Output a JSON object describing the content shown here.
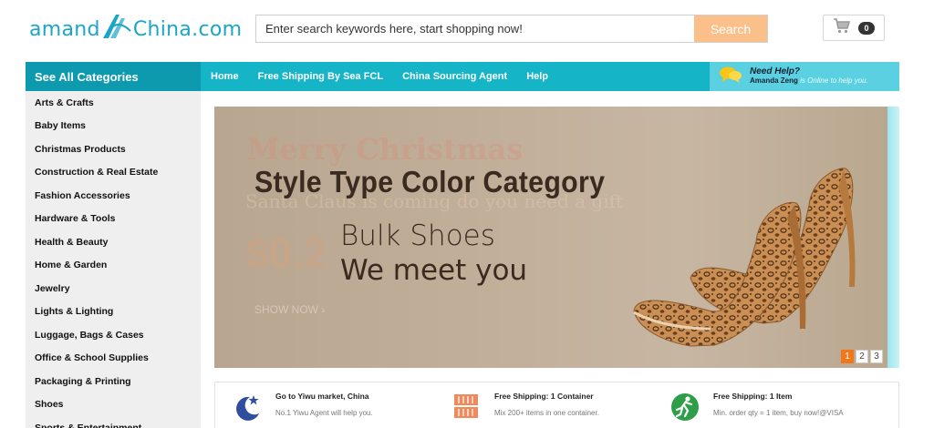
{
  "header": {
    "logo_left": "amand",
    "logo_right": "China.com",
    "search_placeholder": "Enter search keywords here, start shopping now!",
    "search_button": "Search",
    "cart_count": "0"
  },
  "nav": {
    "categories_label": "See All Categories",
    "links": [
      "Home",
      "Free Shipping By Sea FCL",
      "China Sourcing Agent",
      "Help"
    ],
    "help_title": "Need Help?",
    "help_name": "Amanda Zeng",
    "help_status": "is Online to help you."
  },
  "sidebar": {
    "items": [
      "Arts & Crafts",
      "Baby Items",
      "Christmas Products",
      "Construction & Real Estate",
      "Fashion Accessories",
      "Hardware & Tools",
      "Health & Beauty",
      "Home & Garden",
      "Jewelry",
      "Lights & Lighting",
      "Luggage, Bags & Cases",
      "Office & School Supplies",
      "Packaging & Printing",
      "Shoes",
      "Sports & Entertainment"
    ]
  },
  "banner": {
    "title": "Style Type Color Category",
    "line1": "Bulk Shoes",
    "line2": "We meet you",
    "ghost_title": "Merry Christmas",
    "ghost_sub": "Santa Claus is coming do you need a gift",
    "ghost_price": "$0.2",
    "ghost_cta": "SHOW NOW ›",
    "slides": [
      "1",
      "2",
      "3"
    ]
  },
  "features": [
    {
      "icon": "star-moon-icon",
      "title": "Go to Yiwu market, China",
      "desc": "No.1 Yiwu Agent will help you."
    },
    {
      "icon": "container-icon",
      "title": "Free Shipping: 1 Container",
      "desc": "Mix 200+ items in one container."
    },
    {
      "icon": "delivery-runner-icon",
      "title": "Free Shipping: 1 Item",
      "desc": "Min. order qty = 1 item, buy now!@VISA"
    }
  ],
  "colors": {
    "brand": "#16b4c7",
    "brand_dark": "#0e9aae",
    "search_button": "#fbc08a",
    "active_slide": "#f0771a"
  }
}
